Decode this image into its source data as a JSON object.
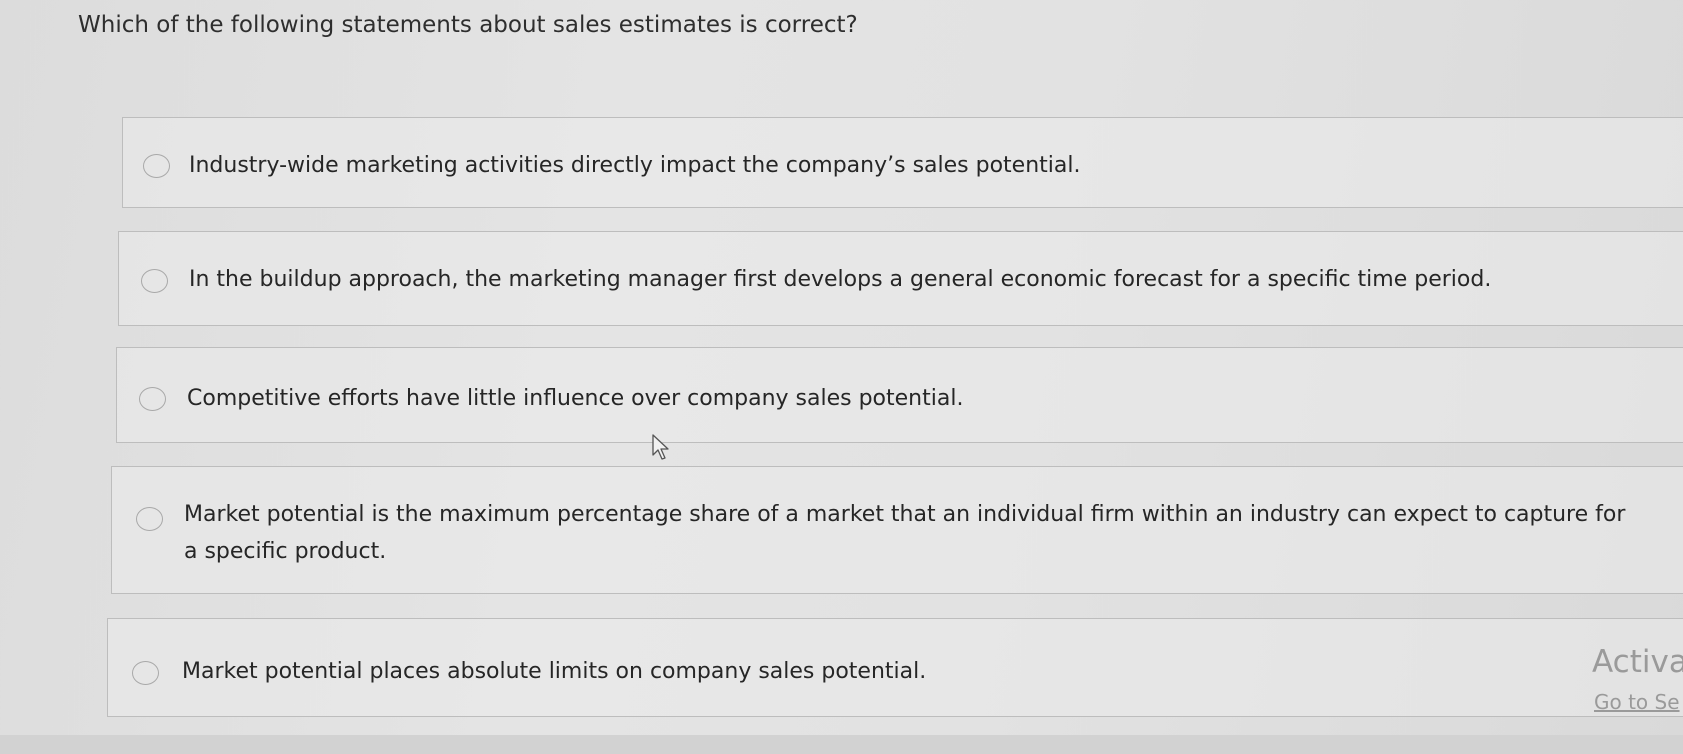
{
  "question": "Which of the following statements about sales estimates is correct?",
  "options": [
    {
      "label": "Industry-wide marketing activities directly impact the company’s sales potential."
    },
    {
      "label": "In the buildup approach, the marketing manager first develops a general economic forecast for a specific time period."
    },
    {
      "label": "Competitive efforts have little influence over company sales potential."
    },
    {
      "label": "Market potential is the maximum percentage share of a market that an individual firm within an industry can expect to capture for a specific product."
    },
    {
      "label": "Market potential places absolute limits on company sales potential."
    }
  ],
  "watermark": {
    "line1": "Activat",
    "line2": "Go to Se"
  }
}
